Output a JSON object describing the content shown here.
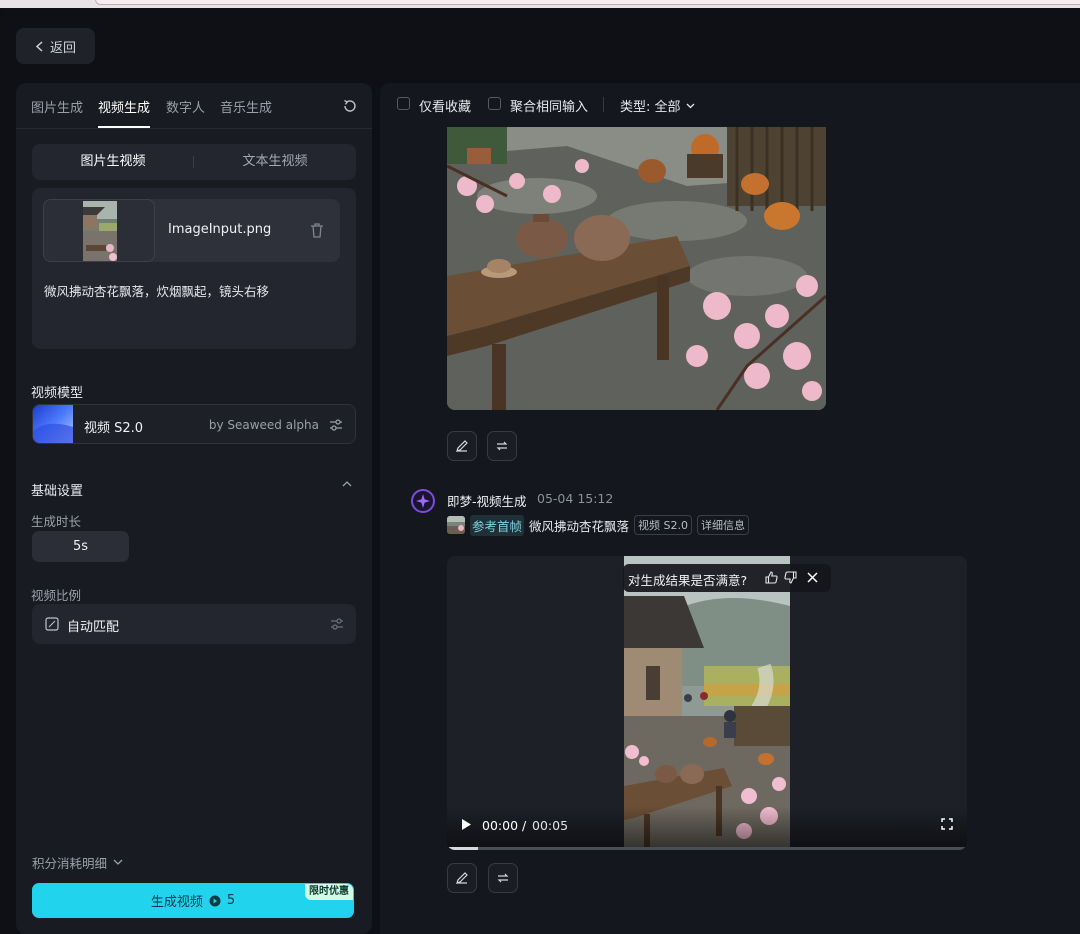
{
  "header": {
    "back_label": "返回"
  },
  "left_panel": {
    "tabs": [
      {
        "label": "图片生成"
      },
      {
        "label": "视频生成"
      },
      {
        "label": "数字人"
      },
      {
        "label": "音乐生成"
      }
    ],
    "modes": [
      {
        "label": "图片生视频"
      },
      {
        "label": "文本生视频"
      }
    ],
    "image_input": {
      "filename": "ImageInput.png"
    },
    "prompt": "微风拂动杏花飘落，炊烟飘起，镜头右移",
    "model_section_title": "视频模型",
    "model": {
      "name": "视频 S2.0",
      "by": "by Seaweed alpha"
    },
    "basic_settings_title": "基础设置",
    "duration_label": "生成时长",
    "duration_value": "5s",
    "ratio_label": "视频比例",
    "ratio_value": "自动匹配",
    "credits_detail": "积分消耗明细",
    "generate": {
      "label": "生成视频",
      "cost": "5",
      "badge": "限时优惠"
    }
  },
  "feed": {
    "filters": {
      "favorites": "仅看收藏",
      "merge_same": "聚合相同输入",
      "type_filter": "类型: 全部"
    },
    "generation": {
      "title": "即梦-视频生成",
      "date": "05-04",
      "time": "15:12",
      "ref_label": "参考首帧",
      "prompt_short": "微风拂动杏花飘落",
      "model_tag": "视频 S2.0",
      "detail_tag": "详细信息"
    },
    "video": {
      "feedback_question": "对生成结果是否满意?",
      "current_time": "00:00",
      "separator": "/",
      "duration": "00:05",
      "progress": 0.06
    }
  },
  "colors": {
    "accent": "#22d3ee",
    "promo_badge": "#d2fbe7",
    "avatar": "#7c4ddb"
  },
  "icons": [
    "chevron-left-icon",
    "refresh-icon",
    "trash-icon",
    "sliders-icon",
    "chevron-up-icon",
    "chevron-down-icon",
    "edit-icon",
    "regenerate-icon",
    "thumbs-up-icon",
    "thumbs-down-icon",
    "close-icon",
    "play-icon",
    "fullscreen-icon",
    "credit-icon",
    "aspect-ratio-icon",
    "sparkle-avatar-icon"
  ]
}
